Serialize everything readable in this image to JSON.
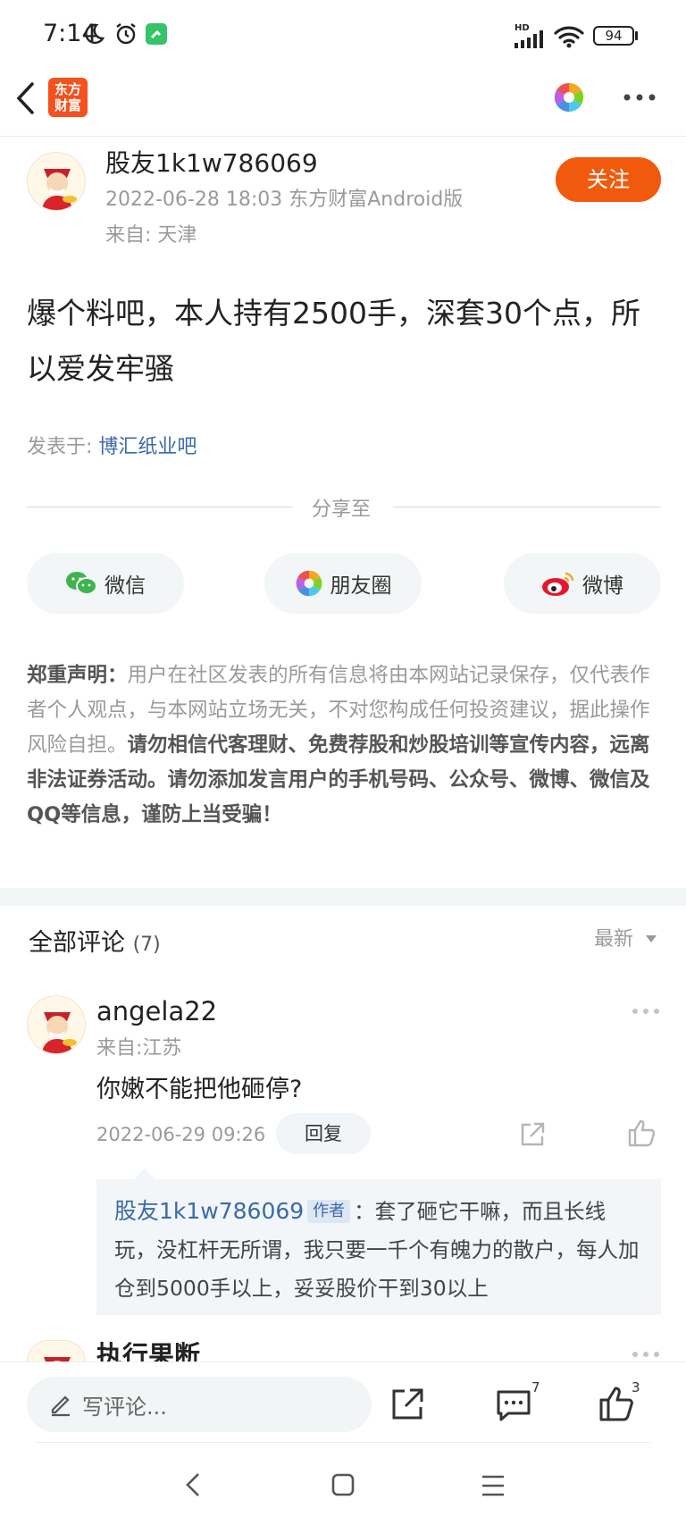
{
  "status_bar": {
    "time": "7:14",
    "battery": "94",
    "network": "HD"
  },
  "app": {
    "logo_text_line1": "东方",
    "logo_text_line2": "财富"
  },
  "post": {
    "author": "股友1k1w786069",
    "meta": "2022-06-28 18:03 东方财富Android版",
    "location": "来自: 天津",
    "follow_label": "关注",
    "body": "爆个料吧，本人持有2500手，深套30个点，所以爱发牢骚",
    "posted_in_label": "发表于: ",
    "posted_in_link": "博汇纸业吧"
  },
  "share": {
    "title": "分享至",
    "wechat": "微信",
    "moments": "朋友圈",
    "weibo": "微博"
  },
  "disclaimer": {
    "label": "郑重声明：",
    "text1": "用户在社区发表的所有信息将由本网站记录保存，仅代表作者个人观点，与本网站立场无关，不对您构成任何投资建议，据此操作风险自担。",
    "text2": "请勿相信代客理财、免费荐股和炒股培训等宣传内容，远离非法证券活动。请勿添加发言用户的手机号码、公众号、微博、微信及QQ等信息，谨防上当受骗！"
  },
  "comments": {
    "title": "全部评论",
    "count": "(7)",
    "sort": "最新",
    "items": [
      {
        "user": "angela22",
        "location": "来自:江苏",
        "text": "你嫩不能把他砸停?",
        "time": "2022-06-29 09:26",
        "reply_label": "回复",
        "reply": {
          "user": "股友1k1w786069",
          "badge": "作者",
          "text": "：套了砸它干嘛，而且长线玩，没杠杆无所谓，我只要一千个有魄力的散户，每人加仓到5000手以上，妥妥股价干到30以上"
        }
      },
      {
        "user": "执行果断"
      }
    ]
  },
  "bottom_bar": {
    "input_placeholder": "写评论...",
    "comment_count": "7",
    "like_count": "3"
  },
  "colors": {
    "accent": "#f15a0c",
    "link": "#3b6aa8"
  }
}
